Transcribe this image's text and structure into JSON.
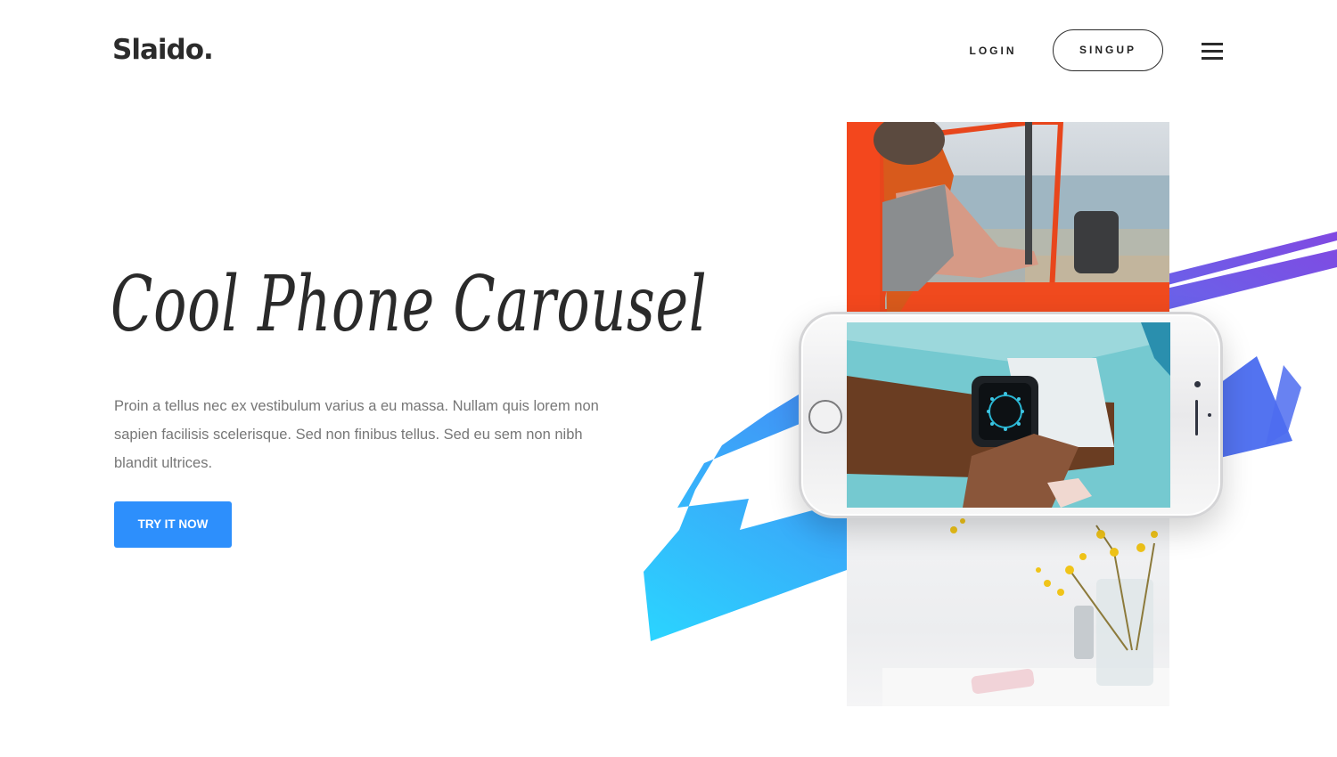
{
  "header": {
    "logo": "Slaido.",
    "login_label": "LOGIN",
    "signup_label": "SINGUP",
    "menu_icon": "hamburger-menu-icon"
  },
  "hero": {
    "title": "Cool Phone Carousel",
    "description": "Proin a tellus nec ex vestibulum varius a eu massa. Nullam quis lorem non sapien facilisis scelerisque. Sed non finibus tellus. Sed eu sem non nibh blandit ultrices.",
    "cta_label": "TRY IT NOW"
  },
  "colors": {
    "accent": "#2d8ffc",
    "text_dark": "#2b2b2b",
    "text_muted": "#777777",
    "brush_start": "#1fd3ff",
    "brush_end": "#7a3fe0"
  },
  "carousel": {
    "slides": [
      {
        "name": "car-window-photo"
      },
      {
        "name": "smartwatch-photo"
      },
      {
        "name": "flowers-table-photo"
      }
    ],
    "active_slide": "smartwatch-photo"
  }
}
